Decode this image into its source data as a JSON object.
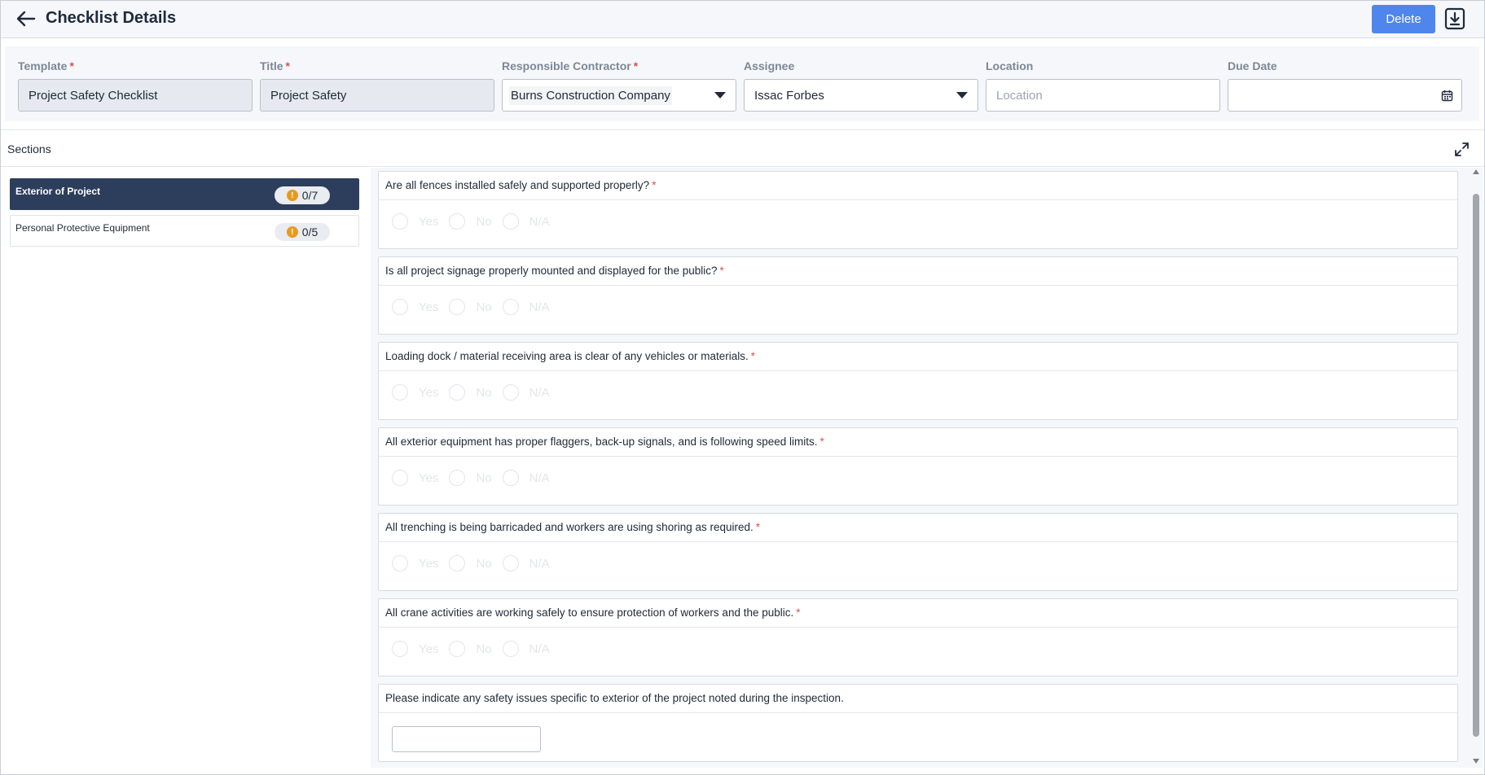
{
  "header": {
    "title": "Checklist Details",
    "delete_label": "Delete"
  },
  "fields": {
    "template": {
      "label": "Template",
      "required": "*",
      "value": "Project Safety Checklist"
    },
    "title": {
      "label": "Title",
      "required": "*",
      "value": "Project Safety"
    },
    "contractor": {
      "label": "Responsible Contractor",
      "required": "*",
      "value": "Burns Construction Company"
    },
    "assignee": {
      "label": "Assignee",
      "value": "Issac Forbes"
    },
    "location": {
      "label": "Location",
      "placeholder": "Location",
      "value": ""
    },
    "due_date": {
      "label": "Due Date",
      "value": ""
    }
  },
  "sections": {
    "title": "Sections",
    "items": [
      {
        "label": "Exterior of Project",
        "progress": "0/7",
        "status_icon": "!"
      },
      {
        "label": "Personal Protective Equipment",
        "progress": "0/5",
        "status_icon": "!"
      }
    ]
  },
  "questions": [
    {
      "text": "Are all fences installed safely and supported properly?",
      "required": "*"
    },
    {
      "text": "Is all project signage properly mounted and displayed for the public?",
      "required": "*"
    },
    {
      "text": "Loading dock / material receiving area is clear of any vehicles or materials.",
      "required": "*"
    },
    {
      "text": "All exterior equipment has proper flaggers, back-up signals, and is following speed limits.",
      "required": "*"
    },
    {
      "text": "All trenching is being barricaded and workers are using shoring as required.",
      "required": "*"
    },
    {
      "text": "All crane activities are working safely to ensure protection of workers and the public.",
      "required": "*"
    },
    {
      "text": "Please indicate any safety issues specific to exterior of the project noted during the inspection.",
      "required": ""
    }
  ],
  "answer_options": {
    "yes": "Yes",
    "no": "No",
    "na": "N/A"
  },
  "colors": {
    "primary": "#4f86ee",
    "nav_active": "#2d3d5c",
    "warning": "#e89a1f",
    "required": "#d9534f"
  }
}
